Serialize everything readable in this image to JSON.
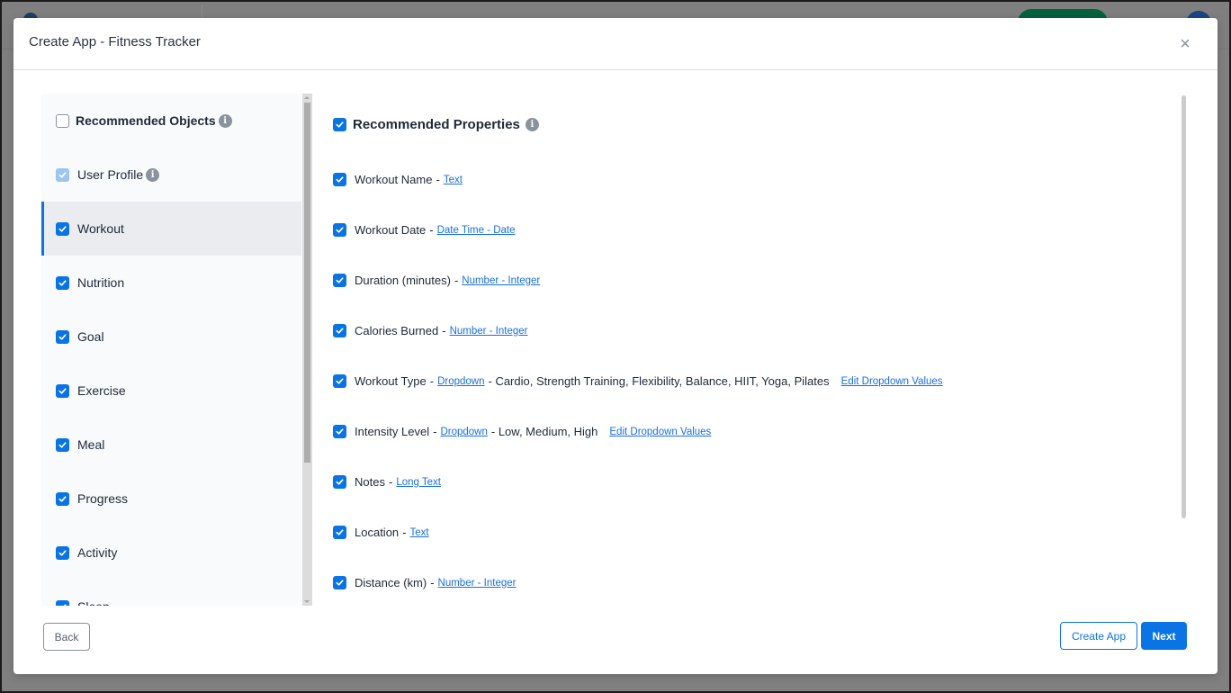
{
  "modal": {
    "title": "Create App - Fitness Tracker",
    "close_icon": "×"
  },
  "sidebar": {
    "header": {
      "label": "Recommended Objects",
      "checked": false,
      "info_icon": "i"
    },
    "items": [
      {
        "label": "User Profile",
        "state": "checked-disabled",
        "info_icon": "i",
        "active": false
      },
      {
        "label": "Workout",
        "state": "checked",
        "active": true
      },
      {
        "label": "Nutrition",
        "state": "checked",
        "active": false
      },
      {
        "label": "Goal",
        "state": "checked",
        "active": false
      },
      {
        "label": "Exercise",
        "state": "checked",
        "active": false
      },
      {
        "label": "Meal",
        "state": "checked",
        "active": false
      },
      {
        "label": "Progress",
        "state": "checked",
        "active": false
      },
      {
        "label": "Activity",
        "state": "checked",
        "active": false
      },
      {
        "label": "Sleep",
        "state": "checked",
        "active": false
      }
    ]
  },
  "properties": {
    "header": {
      "label": "Recommended Properties",
      "checked": true,
      "info_icon": "i"
    },
    "items": [
      {
        "name": "Workout Name",
        "dash": "-",
        "type": "Text",
        "checked": true
      },
      {
        "name": "Workout Date",
        "dash": "-",
        "type": "Date Time - Date",
        "checked": true
      },
      {
        "name": "Duration (minutes)",
        "dash": "-",
        "type": "Number - Integer",
        "checked": true
      },
      {
        "name": "Calories Burned",
        "dash": "-",
        "type": "Number - Integer",
        "checked": true
      },
      {
        "name": "Workout Type",
        "dash": "-",
        "type": "Dropdown",
        "values": "- Cardio, Strength Training, Flexibility, Balance, HIIT, Yoga, Pilates",
        "edit_label": "Edit Dropdown Values",
        "checked": true
      },
      {
        "name": "Intensity Level",
        "dash": "-",
        "type": "Dropdown",
        "values": "- Low, Medium, High",
        "edit_label": "Edit Dropdown Values",
        "checked": true
      },
      {
        "name": "Notes",
        "dash": "-",
        "type": "Long Text",
        "checked": true
      },
      {
        "name": "Location",
        "dash": "-",
        "type": "Text",
        "checked": true
      },
      {
        "name": "Distance (km)",
        "dash": "-",
        "type": "Number - Integer",
        "checked": true
      }
    ]
  },
  "footer": {
    "back_label": "Back",
    "create_label": "Create App",
    "next_label": "Next"
  },
  "colors": {
    "accent": "#0b74e5",
    "link": "#1a6fe0",
    "active_row": "#eaecef",
    "sidebar_bg": "#f8fafc"
  }
}
